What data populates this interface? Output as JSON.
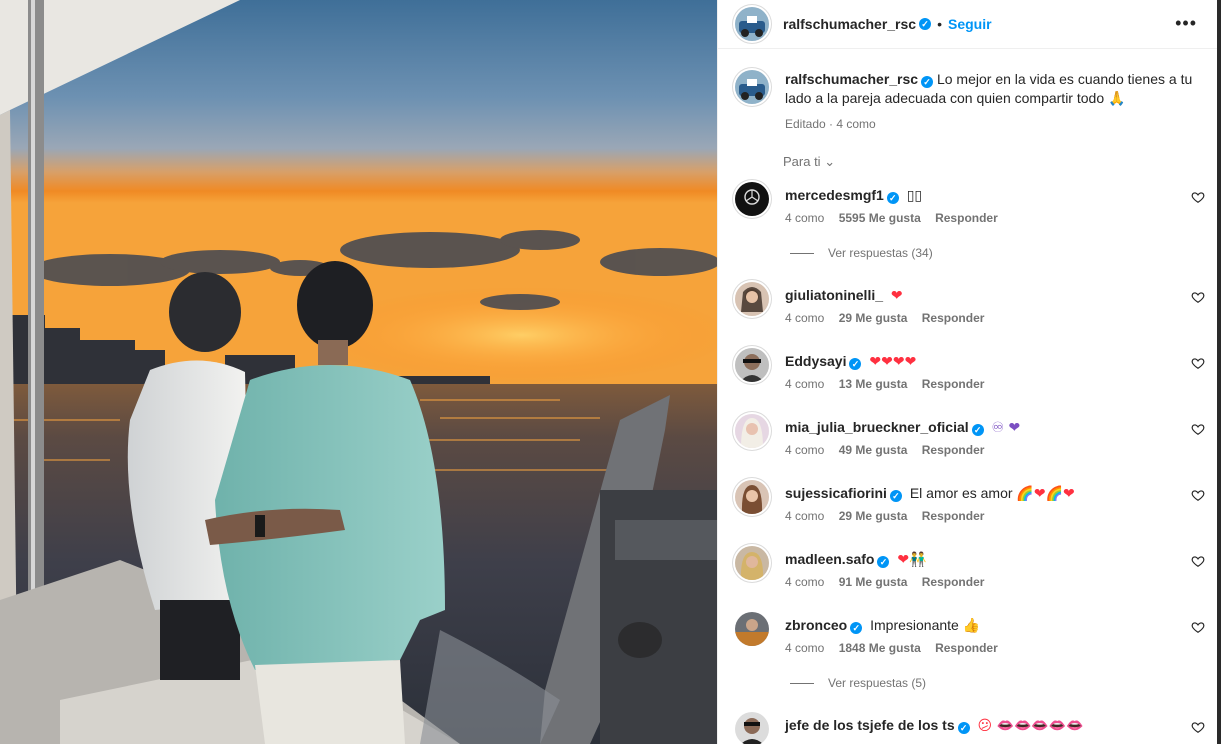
{
  "post": {
    "author": "ralfschumacher_rsc",
    "follow_label": "Seguir",
    "more_label": "•••",
    "caption": "Lo mejor en la vida es cuando tienes a tu lado a la pareja adecuada con quien compartir todo 🙏",
    "edited_label": "Editado",
    "time_label": "· 4 como",
    "sort_label": "Para ti"
  },
  "comments": [
    {
      "user": "mercedesmgf1",
      "verified": true,
      "text": "",
      "emoji": "▯▯",
      "time": "4 como",
      "likes": "5595 Me gusta",
      "reply": "Responder",
      "replies": "Ver respuestas (34)"
    },
    {
      "user": "giuliatoninelli_",
      "verified": false,
      "text": "",
      "emoji": "❤",
      "time": "4 como",
      "likes": "29 Me gusta",
      "reply": "Responder"
    },
    {
      "user": "Eddysayi",
      "verified": true,
      "text": "",
      "emoji": "❤❤❤❤",
      "time": "4 como",
      "likes": "13 Me gusta",
      "reply": "Responder"
    },
    {
      "user": "mia_julia_brueckner_oficial",
      "verified": true,
      "text": "",
      "emoji": "♾ ❤",
      "time": "4 como",
      "likes": "49 Me gusta",
      "reply": "Responder"
    },
    {
      "user": "sujessicafiorini",
      "verified": true,
      "text": "El amor es amor",
      "emoji": "🌈❤🌈❤",
      "time": "4 como",
      "likes": "29 Me gusta",
      "reply": "Responder"
    },
    {
      "user": "madleen.safo",
      "verified": true,
      "text": "",
      "emoji": "❤👬",
      "time": "4 como",
      "likes": "91 Me gusta",
      "reply": "Responder"
    },
    {
      "user": "zbronceo",
      "verified": true,
      "text": "Impresionante",
      "emoji": "👍",
      "time": "4 como",
      "likes": "1848 Me gusta",
      "reply": "Responder",
      "replies": "Ver respuestas (5)"
    },
    {
      "user": "jefe de los tsjefe de los ts",
      "verified": true,
      "text": "",
      "emoji": "😕 👄👄👄👄👄",
      "time": "",
      "likes": "",
      "reply": ""
    }
  ],
  "colors": {
    "accent": "#0095f6",
    "heart": "#ff3040",
    "muted": "#737373"
  }
}
